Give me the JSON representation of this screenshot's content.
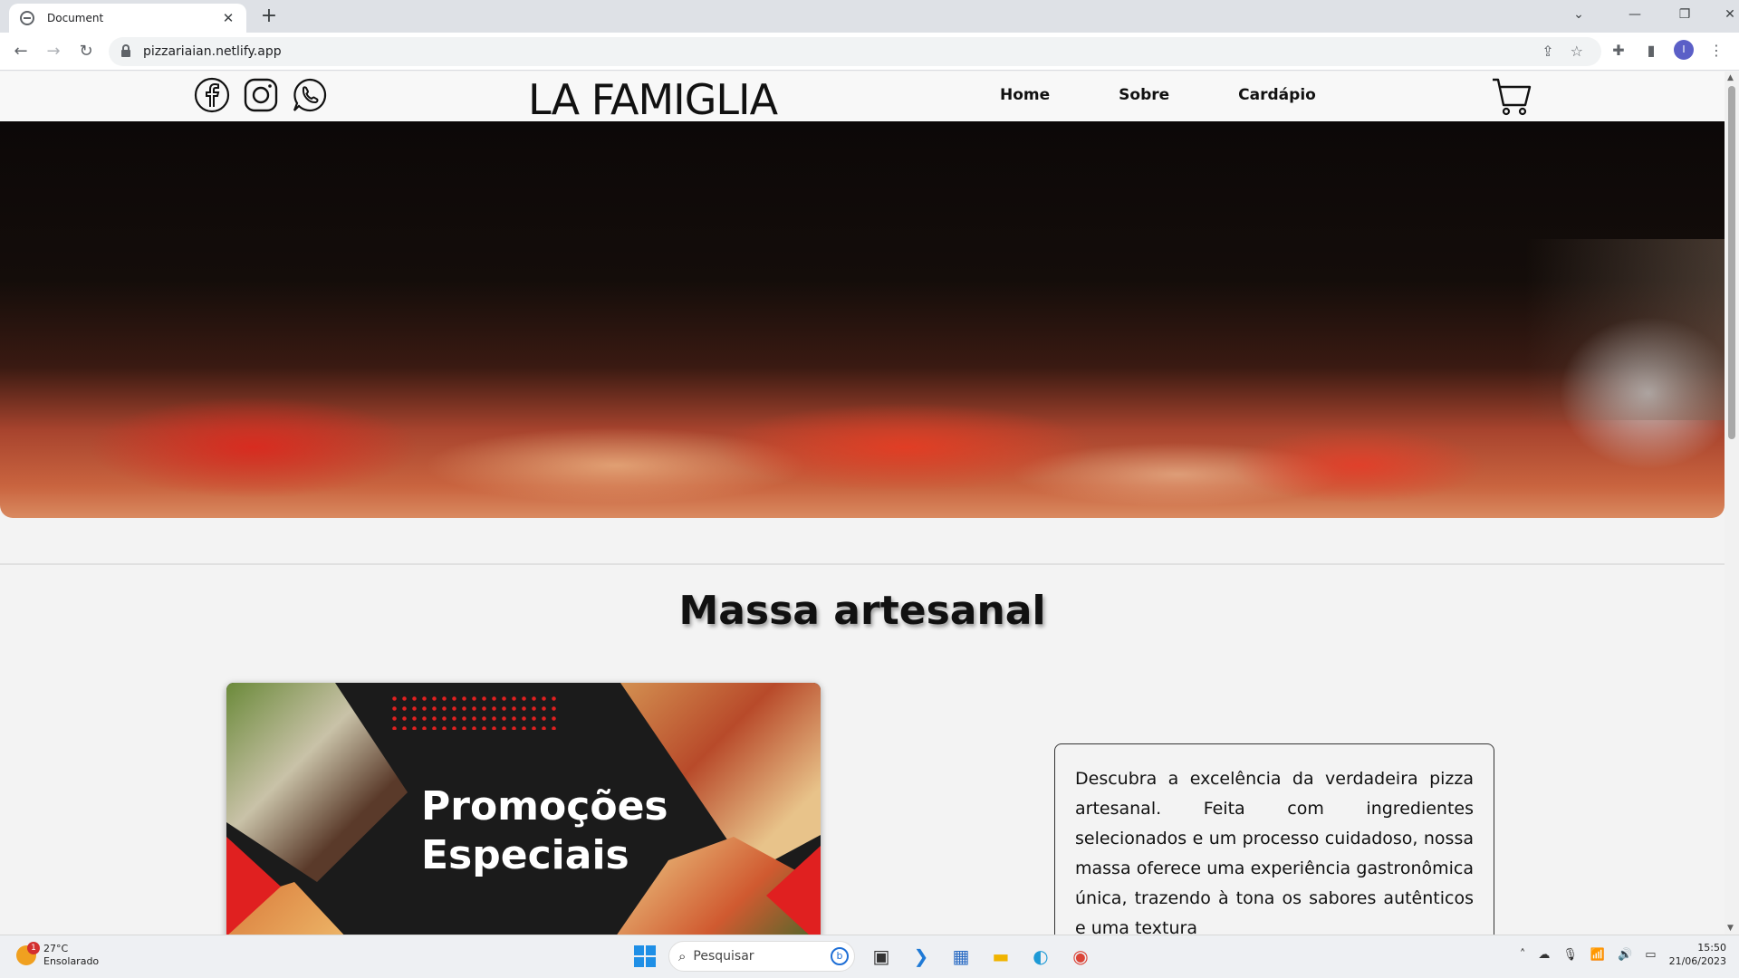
{
  "browser": {
    "tab_title": "Document",
    "tab_close": "✕",
    "new_tab": "+",
    "url": "pizzariaian.netlify.app",
    "profile_initial": "I",
    "back": "←",
    "forward": "→",
    "reload": "↻"
  },
  "site": {
    "logo": "LA FAMIGLIA",
    "nav": [
      "Home",
      "Sobre",
      "Cardápio"
    ],
    "section_title": "Massa artesanal",
    "promo_text_line1": "Promoções",
    "promo_text_line2": "Especiais",
    "description": "Descubra a excelência da verdadeira pizza artesanal. Feita com ingredientes selecionados e um processo cuidadoso, nossa massa oferece uma experiência gastronômica única, trazendo à tona os sabores autênticos e uma textura"
  },
  "taskbar": {
    "weather_temp": "27°C",
    "weather_desc": "Ensolarado",
    "weather_badge": "1",
    "search_placeholder": "Pesquisar",
    "time": "15:50",
    "date": "21/06/2023"
  },
  "colors": {
    "accent_red": "#e02020",
    "windows_blue": "#1f8fe6",
    "profile": "#5b5fc7"
  }
}
